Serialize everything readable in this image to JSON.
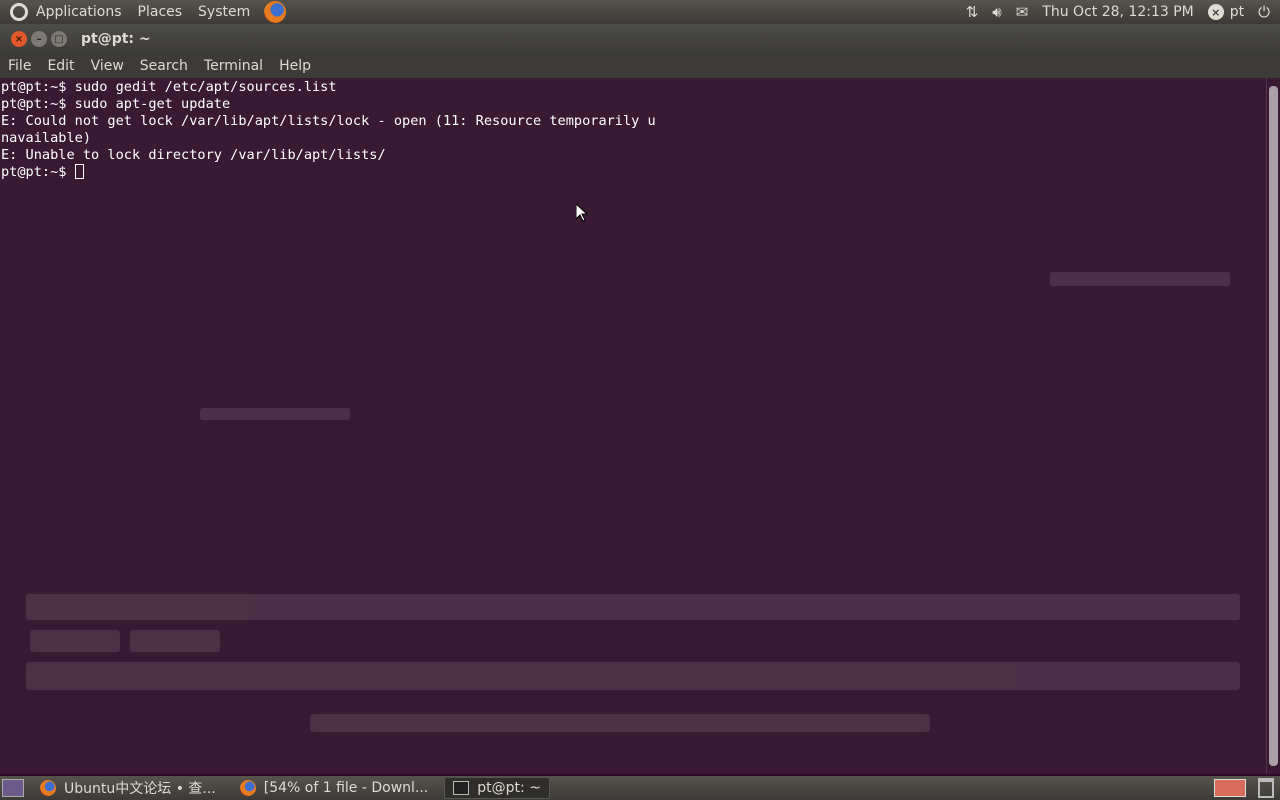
{
  "top_panel": {
    "menus": [
      "Applications",
      "Places",
      "System"
    ],
    "clock": "Thu Oct 28, 12:13 PM",
    "user": "pt"
  },
  "window": {
    "title": "pt@pt: ~"
  },
  "menubar": [
    "File",
    "Edit",
    "View",
    "Search",
    "Terminal",
    "Help"
  ],
  "terminal": {
    "lines": [
      "pt@pt:~$ sudo gedit /etc/apt/sources.list",
      "pt@pt:~$ sudo apt-get update",
      "E: Could not get lock /var/lib/apt/lists/lock - open (11: Resource temporarily u",
      "navailable)",
      "E: Unable to lock directory /var/lib/apt/lists/",
      "pt@pt:~$ "
    ]
  },
  "taskbar": {
    "tasks": [
      {
        "label": "Ubuntu中文论坛 • 查...",
        "icon": "firefox-icon"
      },
      {
        "label": "[54% of 1 file - Downl...",
        "icon": "firefox-icon"
      },
      {
        "label": "pt@pt: ~",
        "icon": "terminal-icon"
      }
    ]
  },
  "colors": {
    "panel": "#3c3b37",
    "terminal_bg": "#3a1a33",
    "close_button": "#e2582b"
  }
}
